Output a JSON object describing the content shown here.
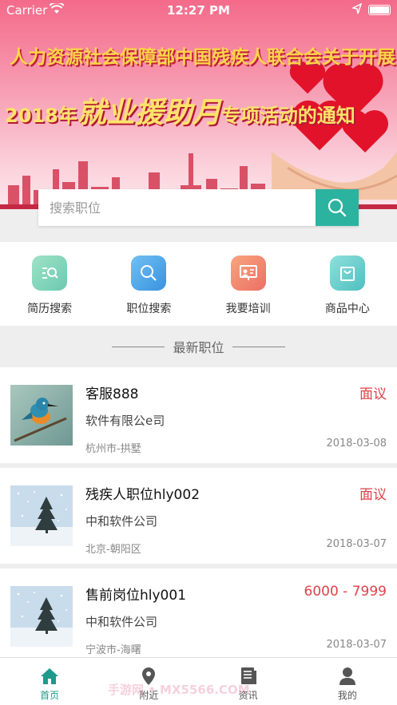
{
  "status_bar": {
    "carrier": "Carrier",
    "time": "12:27 PM"
  },
  "banner": {
    "line1": "人力资源社会保障部中国残疾人联合会关于开展",
    "line2_year": "2018年",
    "line2_main": "就业援助月",
    "line2_tail": "专项活动的通知"
  },
  "search": {
    "placeholder": "搜索职位"
  },
  "quick_menu": [
    {
      "label": "简历搜索",
      "icon": "resume-search-icon",
      "color": "#7dd3b3"
    },
    {
      "label": "职位搜索",
      "icon": "job-search-icon",
      "color": "#4aa8e8"
    },
    {
      "label": "我要培训",
      "icon": "training-icon",
      "color": "#f08a6a"
    },
    {
      "label": "商品中心",
      "icon": "shopping-bag-icon",
      "color": "#5cc9c4"
    }
  ],
  "section_title": "最新职位",
  "jobs": [
    {
      "title": "客服888",
      "company": "软件有限公e司",
      "location": "杭州市-拱墅",
      "salary": "面议",
      "date": "2018-03-08",
      "image": "kingfisher"
    },
    {
      "title": "残疾人职位hly002",
      "company": "中和软件公司",
      "location": "北京-朝阳区",
      "salary": "面议",
      "date": "2018-03-07",
      "image": "snow-tree"
    },
    {
      "title": "售前岗位hly001",
      "company": "中和软件公司",
      "location": "宁波市-海曙",
      "salary": "6000 - 7999",
      "date": "2018-03-07",
      "image": "snow-tree"
    }
  ],
  "tabs": [
    {
      "label": "首页",
      "icon": "home-icon",
      "active": true
    },
    {
      "label": "附近",
      "icon": "location-pin-icon",
      "active": false
    },
    {
      "label": "资讯",
      "icon": "news-icon",
      "active": false
    },
    {
      "label": "我的",
      "icon": "profile-icon",
      "active": false
    }
  ],
  "watermark": "手游网 • MX5566.COM",
  "colors": {
    "accent": "#2bb3a0",
    "salary": "#e0424a",
    "tab_active": "#1d9a8a"
  }
}
